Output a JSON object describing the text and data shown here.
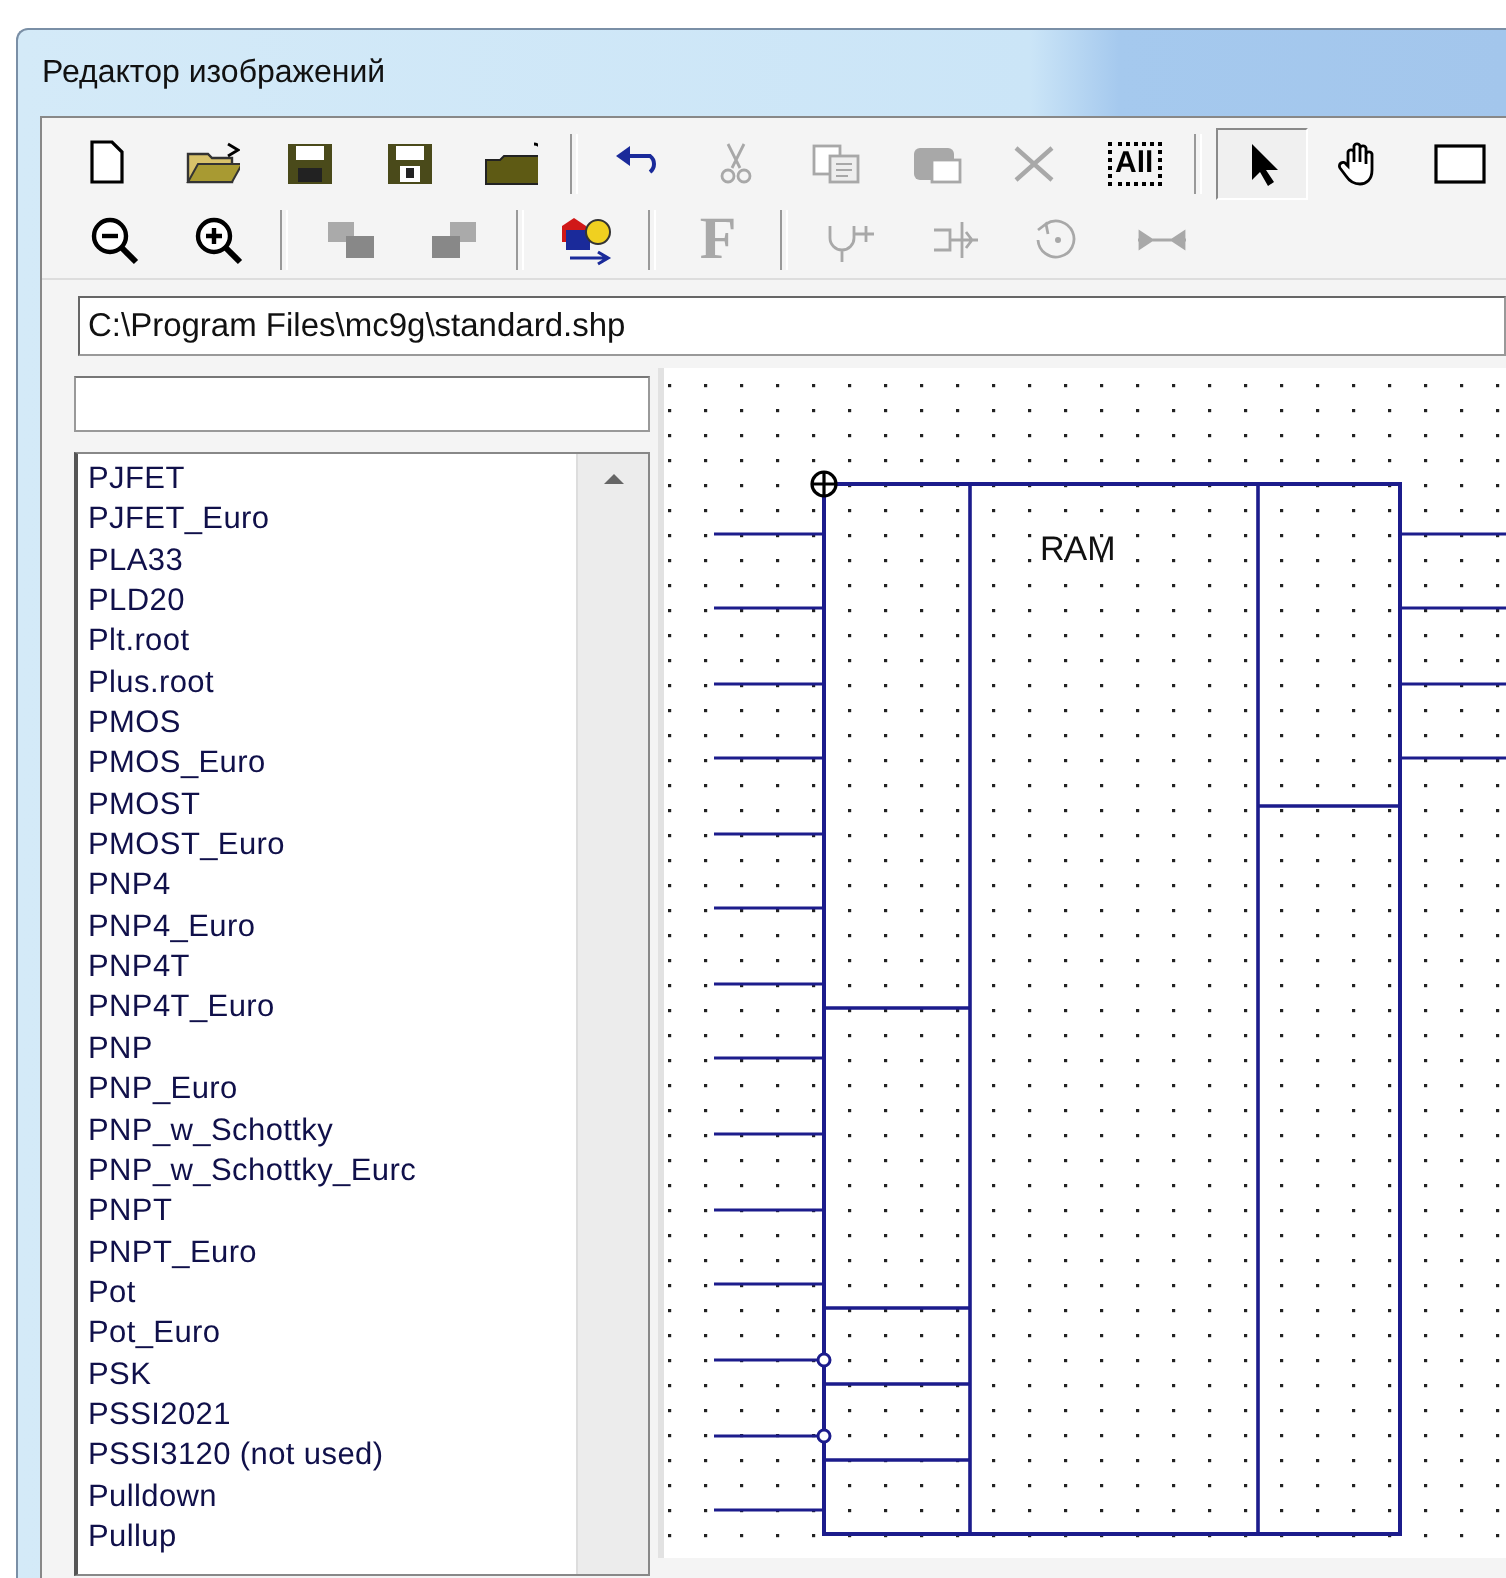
{
  "window": {
    "title": "Редактор изображений"
  },
  "toolbars": [
    {
      "items": [
        {
          "kind": "icon",
          "disabled": false,
          "pressed": false
        },
        {
          "kind": "icon",
          "disabled": false,
          "pressed": false
        },
        {
          "kind": "icon",
          "disabled": false,
          "pressed": false
        },
        {
          "kind": "icon",
          "disabled": false,
          "pressed": false
        },
        {
          "kind": "icon",
          "disabled": false,
          "pressed": false
        },
        {
          "kind": "separator"
        },
        {
          "kind": "icon",
          "disabled": false,
          "pressed": false
        },
        {
          "kind": "icon",
          "disabled": true,
          "pressed": false
        },
        {
          "kind": "icon",
          "disabled": true,
          "pressed": false
        },
        {
          "kind": "icon",
          "disabled": true,
          "pressed": false
        },
        {
          "kind": "icon",
          "disabled": true,
          "pressed": false
        },
        {
          "kind": "text",
          "label": "All",
          "disabled": false,
          "pressed": false
        },
        {
          "kind": "separator"
        },
        {
          "kind": "icon",
          "disabled": false,
          "pressed": true
        },
        {
          "kind": "icon",
          "disabled": false,
          "pressed": false
        },
        {
          "kind": "icon",
          "disabled": false,
          "pressed": false
        }
      ]
    },
    {
      "items": [
        {
          "kind": "icon",
          "disabled": false,
          "pressed": false
        },
        {
          "kind": "icon",
          "disabled": false,
          "pressed": false
        },
        {
          "kind": "separator"
        },
        {
          "kind": "icon",
          "disabled": true,
          "pressed": false
        },
        {
          "kind": "icon",
          "disabled": true,
          "pressed": false
        },
        {
          "kind": "separator"
        },
        {
          "kind": "icon",
          "disabled": false,
          "pressed": false
        },
        {
          "kind": "separator"
        },
        {
          "kind": "text",
          "label": "F",
          "disabled": true,
          "pressed": false
        },
        {
          "kind": "separator"
        },
        {
          "kind": "icon",
          "disabled": true,
          "pressed": false
        },
        {
          "kind": "icon",
          "disabled": true,
          "pressed": false
        },
        {
          "kind": "icon",
          "disabled": true,
          "pressed": false
        },
        {
          "kind": "icon",
          "disabled": true,
          "pressed": false
        }
      ]
    }
  ],
  "path_field": {
    "value": "C:\\Program Files\\mc9g\\standard.shp"
  },
  "shape_list": {
    "items": [
      "PJFET",
      "PJFET_Euro",
      "PLA33",
      "PLD20",
      "Plt.root",
      "Plus.root",
      "PMOS",
      "PMOS_Euro",
      "PMOST",
      "PMOST_Euro",
      "PNP4",
      "PNP4_Euro",
      "PNP4T",
      "PNP4T_Euro",
      "PNP",
      "PNP_Euro",
      "PNP_w_Schottky",
      "PNP_w_Schottky_Eurc",
      "PNPT",
      "PNPT_Euro",
      "Pot",
      "Pot_Euro",
      "PSK",
      "PSSI2021",
      "PSSI3120 (not used)",
      "Pulldown",
      "Pullup"
    ]
  },
  "canvas": {
    "block_label": "RAM"
  }
}
